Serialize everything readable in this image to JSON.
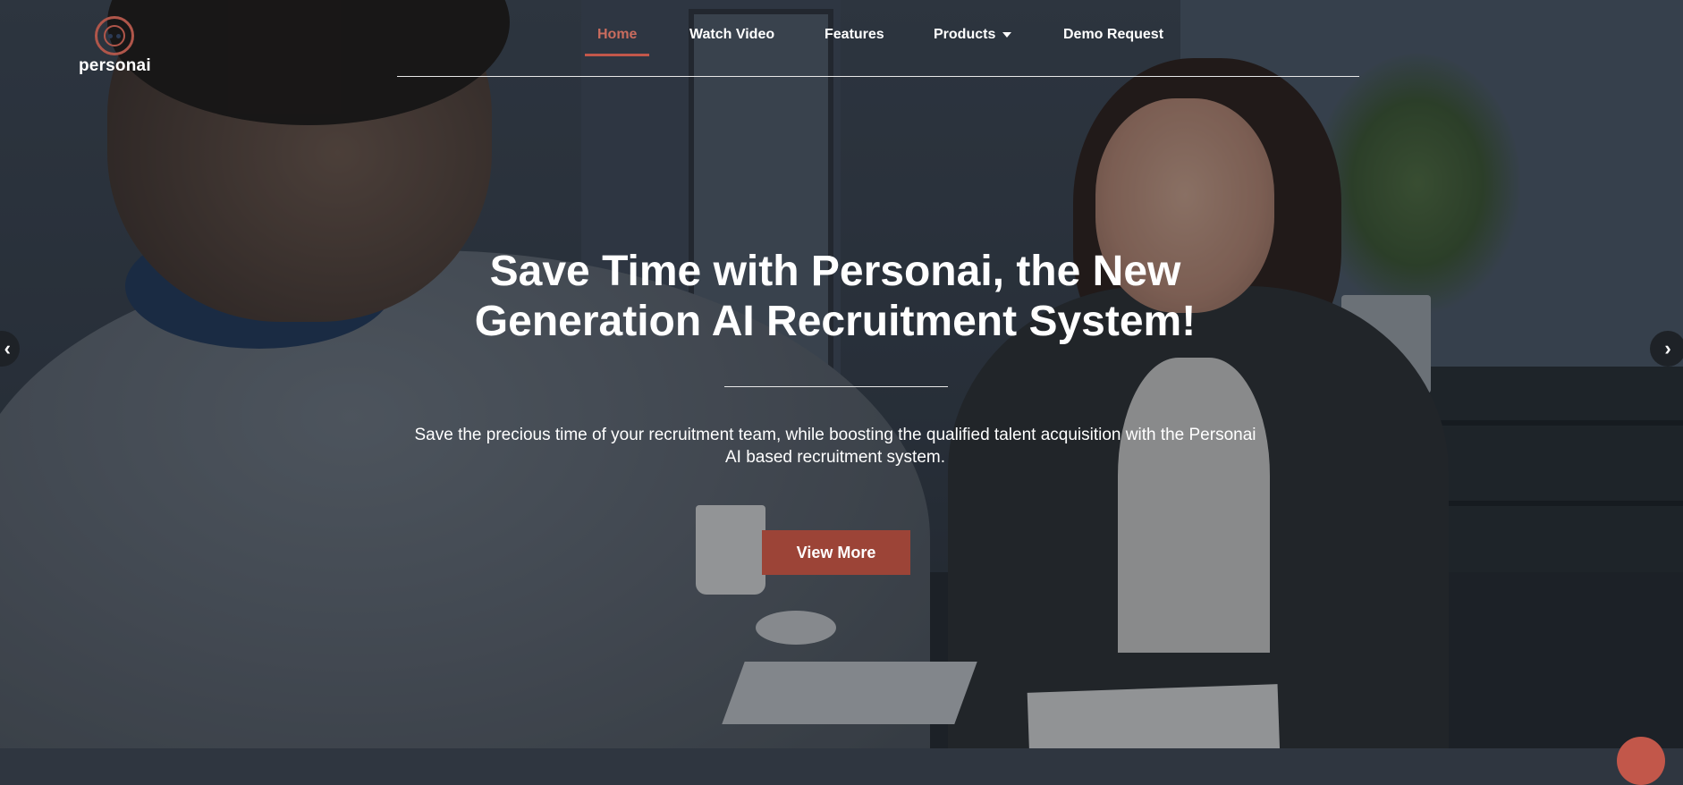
{
  "brand": {
    "name": "personai",
    "accent": "#c2574a",
    "button_color": "#9c4437"
  },
  "nav": {
    "items": [
      {
        "label": "Home",
        "active": true
      },
      {
        "label": "Watch Video"
      },
      {
        "label": "Features"
      },
      {
        "label": "Products",
        "has_dropdown": true
      },
      {
        "label": "Demo Request"
      }
    ]
  },
  "hero": {
    "title": "Save Time with Personai, the New Generation AI Recruitment System!",
    "subtitle": "Save the precious time of your recruitment team, while boosting the qualified talent acquisition with the Personai AI based recruitment system.",
    "cta_label": "View More"
  },
  "slider": {
    "prev_icon": "chevron-left-icon",
    "next_icon": "chevron-right-icon"
  }
}
